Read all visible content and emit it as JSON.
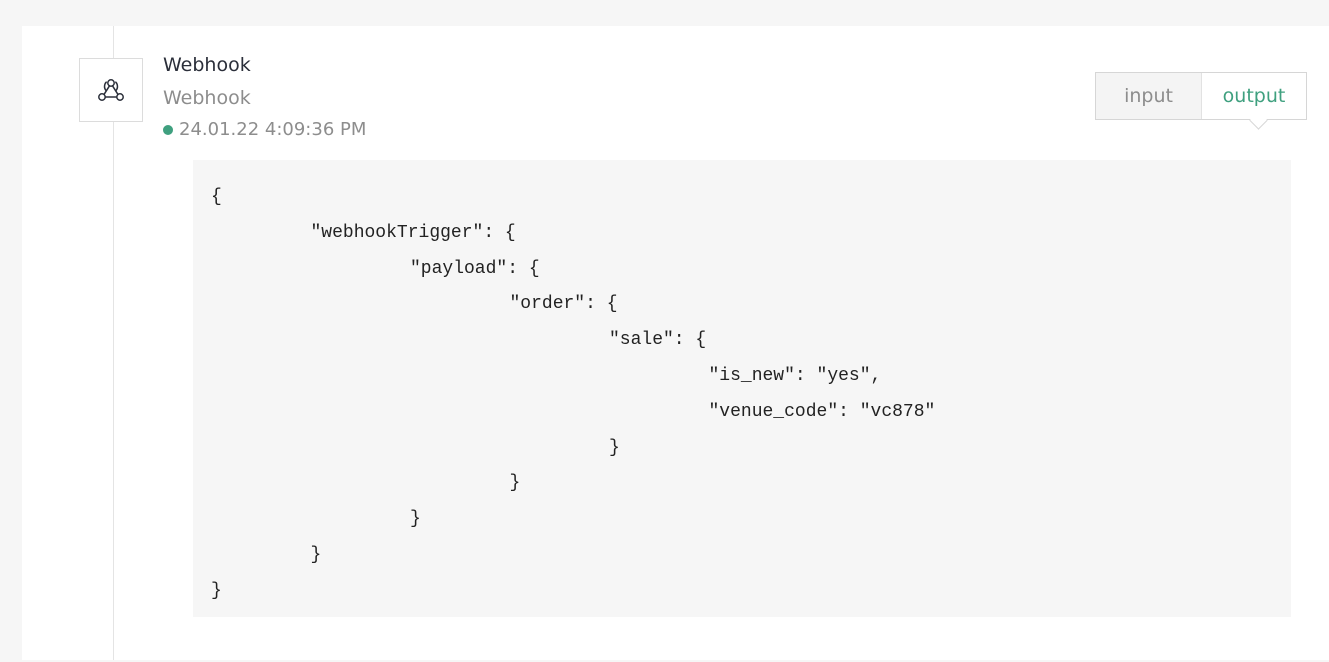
{
  "node": {
    "icon": "webhook-icon",
    "title": "Webhook",
    "subtitle": "Webhook",
    "timestamp": "24.01.22 4:09:36 PM",
    "status_color": "#3fa07f"
  },
  "tabs": {
    "input_label": "input",
    "output_label": "output",
    "active": "output"
  },
  "code": {
    "lines": [
      {
        "indent": 0,
        "text": "{"
      },
      {
        "indent": 1,
        "text": "\"webhookTrigger\": {"
      },
      {
        "indent": 2,
        "text": "\"payload\": {"
      },
      {
        "indent": 3,
        "text": "\"order\": {"
      },
      {
        "indent": 4,
        "text": "\"sale\": {"
      },
      {
        "indent": 5,
        "text": "\"is_new\": \"yes\","
      },
      {
        "indent": 5,
        "text": "\"venue_code\": \"vc878\""
      },
      {
        "indent": 4,
        "text": "}"
      },
      {
        "indent": 3,
        "text": "}"
      },
      {
        "indent": 2,
        "text": "}"
      },
      {
        "indent": 1,
        "text": "}"
      },
      {
        "indent": 0,
        "text": "}"
      }
    ]
  },
  "colors": {
    "accent": "#3fa07f",
    "muted_text": "#8d8d8d",
    "code_background": "#f6f6f6"
  }
}
